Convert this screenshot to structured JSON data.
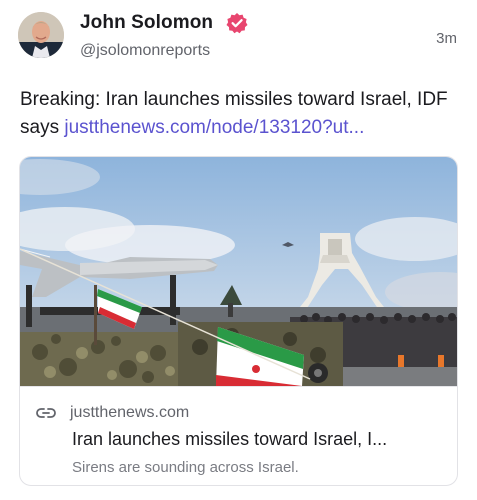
{
  "author": {
    "name": "John Solomon",
    "handle": "@jsolomonreports",
    "verified_icon": "verified-badge-icon"
  },
  "timestamp": "3m",
  "post": {
    "text": "Breaking: Iran launches missiles toward Israel, IDF says ",
    "link_text": "justthenews.com/node/133120?ut..."
  },
  "link_card": {
    "domain": "justthenews.com",
    "title": "Iran launches missiles toward Israel, I...",
    "description": "Sirens are sounding across Israel.",
    "icon": "link-icon"
  },
  "colors": {
    "link": "#5b53cf",
    "verified": "#e8466f",
    "text_primary": "#1b1b1f",
    "text_secondary": "#62646b"
  }
}
